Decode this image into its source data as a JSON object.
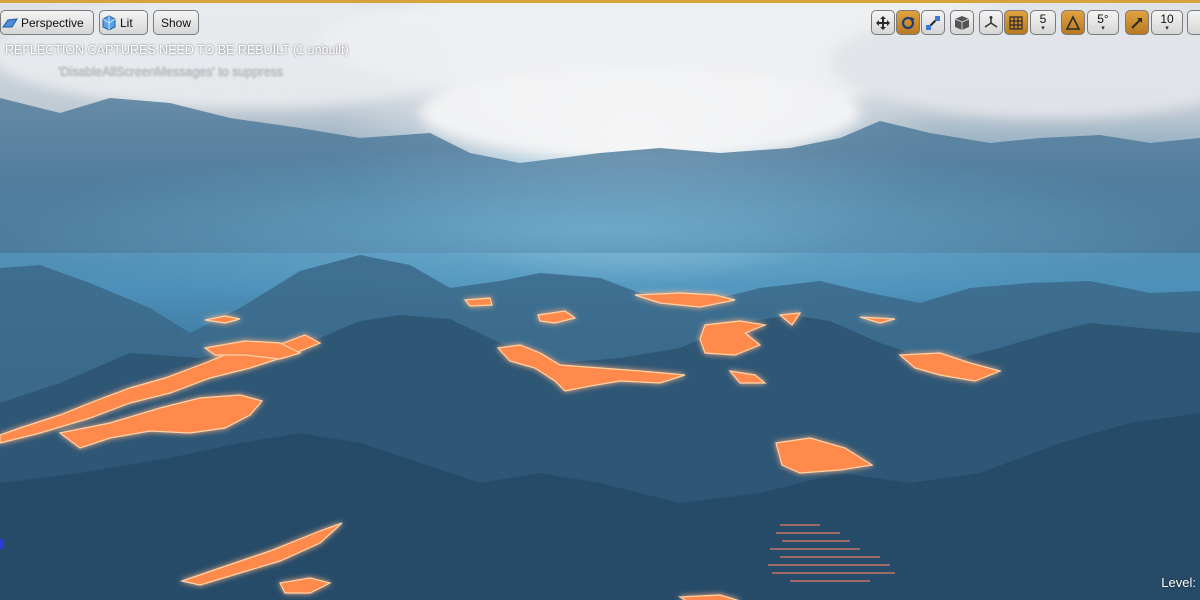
{
  "toolbar": {
    "perspective_label": "Perspective",
    "lit_label": "Lit",
    "show_label": "Show",
    "grid_snap_value": "5",
    "rotation_snap_value": "5°",
    "scale_snap_value": "10"
  },
  "messages": {
    "warning": "REFLECTION CAPTURES NEED TO BE REBUILT (1 unbuilt)",
    "hint": "'DisableAllScreenMessages' to suppress"
  },
  "status": {
    "level_label": "Level:"
  },
  "colors": {
    "accent": "#d6a43a",
    "active_button": "#c8892c",
    "lava": "#ff7a3c",
    "fog": "#3f7ea4"
  }
}
